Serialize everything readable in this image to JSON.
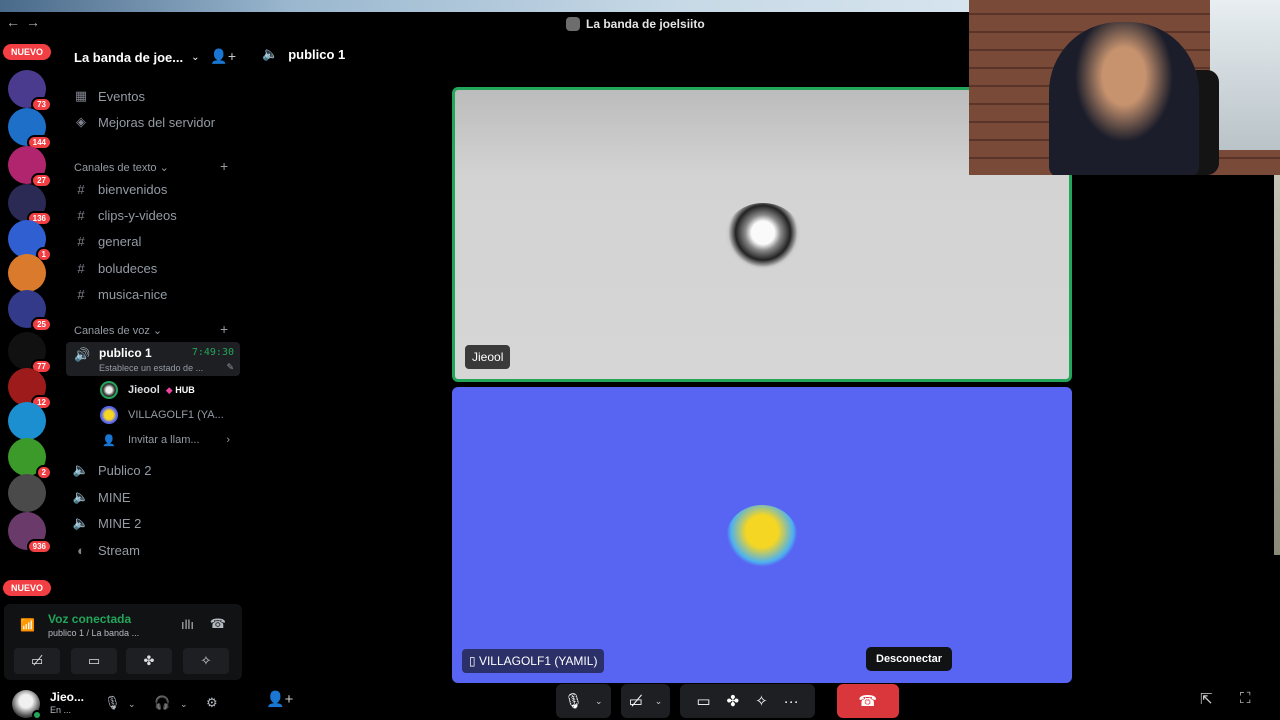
{
  "window": {
    "title": "La banda de joelsiito"
  },
  "server": {
    "name": "La banda de joe..."
  },
  "server_rail": [
    {
      "badge": "NUEVO",
      "kind": "pill"
    },
    {
      "badge": "73",
      "color": "#4b3b8f"
    },
    {
      "badge": "144",
      "color": "#1e6fc7"
    },
    {
      "badge": "27",
      "color": "#b1246e"
    },
    {
      "badge": "136",
      "color": "#2a2a55"
    },
    {
      "badge": "1",
      "color": "#2f5fd0"
    },
    {
      "badge": "",
      "color": "#d97a2c"
    },
    {
      "badge": "25",
      "color": "#333a8a"
    },
    {
      "badge": "77",
      "color": "#111111"
    },
    {
      "badge": "12",
      "color": "#9e1b1b"
    },
    {
      "badge": "",
      "color": "#1c8fd0"
    },
    {
      "badge": "2",
      "color": "#3c9a2b"
    },
    {
      "badge": "",
      "color": "#4a4a4a"
    },
    {
      "badge": "936",
      "color": "#6a3b6a"
    },
    {
      "badge": "NUEVO",
      "kind": "pill"
    }
  ],
  "sidebar": {
    "top_items": [
      {
        "label": "Eventos",
        "icon": "calendar-icon"
      },
      {
        "label": "Mejoras del servidor",
        "icon": "boost-icon"
      }
    ],
    "text_category": "Canales de texto",
    "text_channels": [
      "bienvenidos",
      "clips-y-videos",
      "general",
      "boludeces",
      "musica-nice"
    ],
    "voice_category": "Canales de voz",
    "active_voice": {
      "name": "publico 1",
      "timer": "7:49:30",
      "status": "Establece un estado de ..."
    },
    "voice_users": [
      {
        "name": "Jieool",
        "tag": "HUB"
      },
      {
        "name": "VILLAGOLF1 (YA..."
      }
    ],
    "invite_label": "Invitar a llam...",
    "other_voice": [
      "Publico 2",
      "MINE",
      "MINE 2",
      "Stream"
    ]
  },
  "voice_panel": {
    "status": "Voz conectada",
    "subtitle": "publico 1 / La banda ..."
  },
  "user_panel": {
    "name": "Jieo...",
    "status": "En ..."
  },
  "main": {
    "channel_title": "publico 1",
    "participants": [
      {
        "name": "Jieool"
      },
      {
        "name": "VILLAGOLF1 (YAMIL)"
      }
    ],
    "tooltip": "Desconectar"
  },
  "colors": {
    "speaking": "#23a55a",
    "blurple": "#5865f2",
    "danger": "#da373c"
  }
}
